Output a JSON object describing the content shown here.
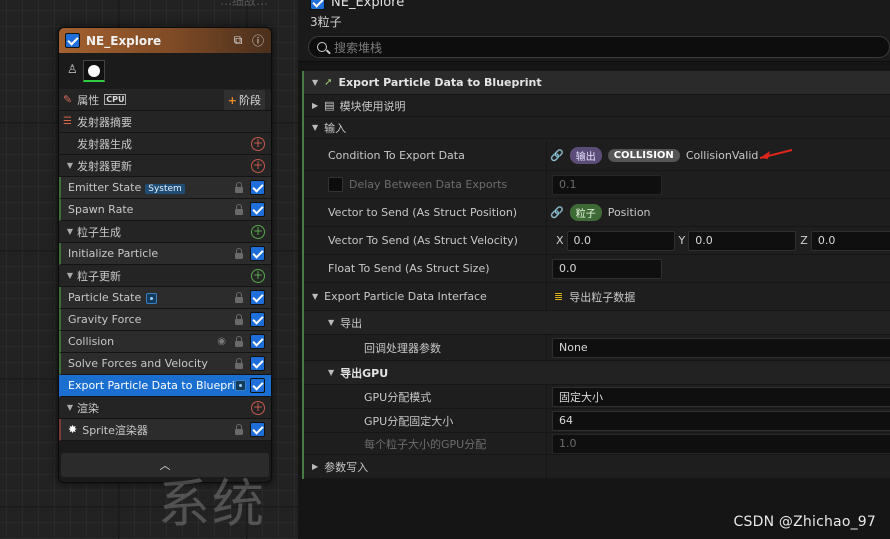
{
  "graph": {
    "top_cut_text": "…细敌…",
    "watermark_text": "系统"
  },
  "node": {
    "title": "NE_Explore",
    "properties_label": "属性",
    "cpu_label": "CPU",
    "stage_label": "阶段",
    "emitter_summary": "发射器摘要",
    "emitter_spawn": "发射器生成",
    "emitter_update": "发射器更新",
    "emitter_state": "Emitter State",
    "emitter_state_tag": "System",
    "spawn_rate": "Spawn Rate",
    "particle_spawn": "粒子生成",
    "initialize_particle": "Initialize Particle",
    "particle_update": "粒子更新",
    "particle_state": "Particle State",
    "gravity_force": "Gravity Force",
    "collision": "Collision",
    "solve_forces": "Solve Forces and Velocity",
    "export_particle": "Export Particle Data to Blueprint",
    "render": "渲染",
    "sprite_renderer": "Sprite渲染器"
  },
  "panel": {
    "emitter_name": "NE_Explore",
    "subtitle": "3粒子",
    "search_placeholder": "搜索堆栈",
    "module_title": "Export Particle Data to Blueprint",
    "module_usage": "模块使用说明",
    "inputs": "输入",
    "condition_label": "Condition To Export Data",
    "condition_pill_output": "输出",
    "condition_pill_collision": "COLLISION",
    "condition_value": "CollisionValid",
    "delay_label": "Delay Between Data Exports",
    "delay_value": "0.1",
    "vec_pos_label": "Vector to Send (As Struct Position)",
    "vec_pos_pill": "粒子",
    "vec_pos_value": "Position",
    "vec_vel_label": "Vector To Send (As Struct Velocity)",
    "x_label": "X",
    "y_label": "Y",
    "z_label": "Z",
    "vec_vel_x": "0.0",
    "vec_vel_y": "0.0",
    "vec_vel_z": "0.0",
    "float_label": "Float To Send (As Struct Size)",
    "float_value": "0.0",
    "interface_label": "Export Particle Data Interface",
    "interface_value": "导出粒子数据",
    "export_section": "导出",
    "callback_label": "回调处理器参数",
    "callback_value": "None",
    "export_gpu_section": "导出GPU",
    "gpu_mode_label": "GPU分配模式",
    "gpu_mode_value": "固定大小",
    "gpu_fixed_label": "GPU分配固定大小",
    "gpu_fixed_value": "64",
    "gpu_per_particle_label": "每个粒子大小的GPU分配",
    "gpu_per_particle_value": "1.0",
    "param_write": "参数写入"
  },
  "watermark": "CSDN @Zhichao_97",
  "colors": {
    "node_header": "#a3612f",
    "selection": "#1a6fd1",
    "checkbox": "#1e6fd9",
    "add_red": "#c65a4c",
    "add_green": "#57a84c",
    "annotation_arrow": "#e0261c"
  }
}
